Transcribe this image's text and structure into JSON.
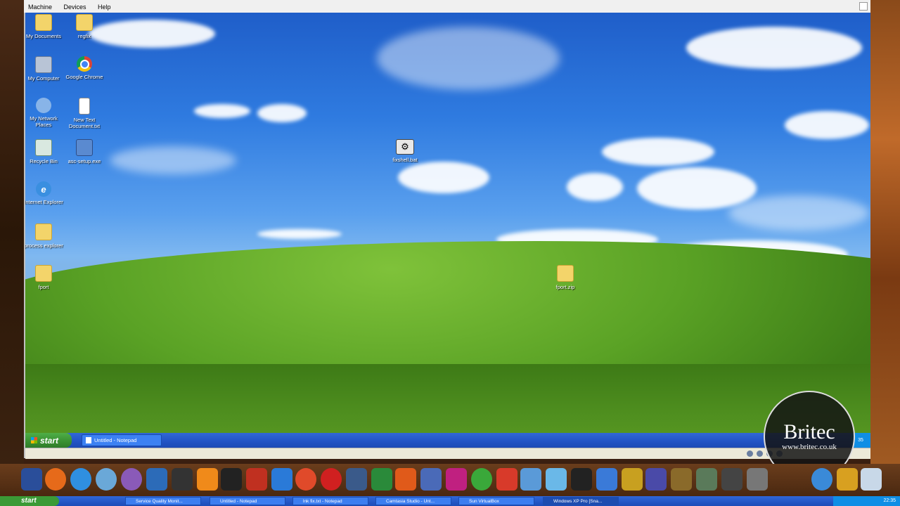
{
  "vbox_menu": [
    "Machine",
    "Devices",
    "Help"
  ],
  "desktop_icons": [
    {
      "label": "My Documents",
      "icon": "folder-icon"
    },
    {
      "label": "regfix",
      "icon": "folder-icon"
    },
    {
      "label": "My Computer",
      "icon": "computer-icon"
    },
    {
      "label": "Google Chrome",
      "icon": "chrome-icon"
    },
    {
      "label": "My Network Places",
      "icon": "network-places-icon"
    },
    {
      "label": "New Text Document.txt",
      "icon": "text-document-icon"
    },
    {
      "label": "Recycle Bin",
      "icon": "recycle-bin-icon"
    },
    {
      "label": "asc-setup.exe",
      "icon": "setup-icon"
    },
    {
      "label": "Internet Explorer",
      "icon": "internet-explorer-icon"
    },
    {
      "label": "process explorer",
      "icon": "folder-icon"
    },
    {
      "label": "fport",
      "icon": "folder-icon"
    },
    {
      "label": "fixshell.bat",
      "icon": "batch-file-icon"
    },
    {
      "label": "fport.zip",
      "icon": "zip-folder-icon"
    }
  ],
  "guest_taskbar": {
    "start_label": "start",
    "tasks": [
      "Untitled - Notepad"
    ],
    "clock": "35"
  },
  "watermark": {
    "title": "Britec",
    "url": "www.britec.co.uk"
  },
  "host_taskbar": {
    "start_label": "start",
    "tasks": [
      "Service Quality Monit...",
      "Untitled - Notepad",
      "lnk fix.txt - Notepad",
      "Camtasia Studio - Unt...",
      "Sun VirtualBox",
      "Windows XP Pro [Sna..."
    ],
    "clock": "22:35"
  },
  "colors": {
    "xp_taskbar": "#2456c8",
    "xp_start": "#388f31",
    "sky": "#2f7be0",
    "grass": "#5aa225"
  }
}
